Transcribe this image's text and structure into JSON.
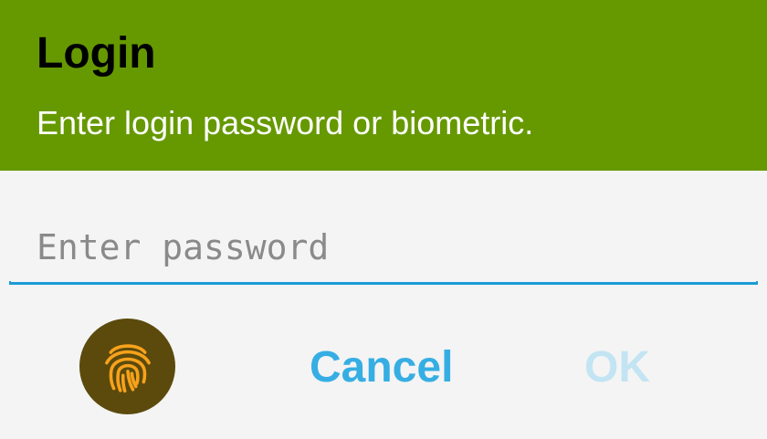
{
  "dialog": {
    "title": "Login",
    "subtitle": "Enter login password or biometric.",
    "password_placeholder": "Enter password",
    "password_value": "",
    "fingerprint_icon": "fingerprint-icon",
    "cancel_label": "Cancel",
    "ok_label": "OK",
    "ok_enabled": false
  },
  "colors": {
    "header_bg": "#669900",
    "title": "#000000",
    "subtitle": "#ffffff",
    "body_bg": "#f4f4f4",
    "accent": "#1b9bd6",
    "cancel": "#36aee3",
    "ok_disabled": "#c3e4f2",
    "fingerprint_bg": "#5b4a0c",
    "fingerprint_stroke": "#f7a21b"
  }
}
